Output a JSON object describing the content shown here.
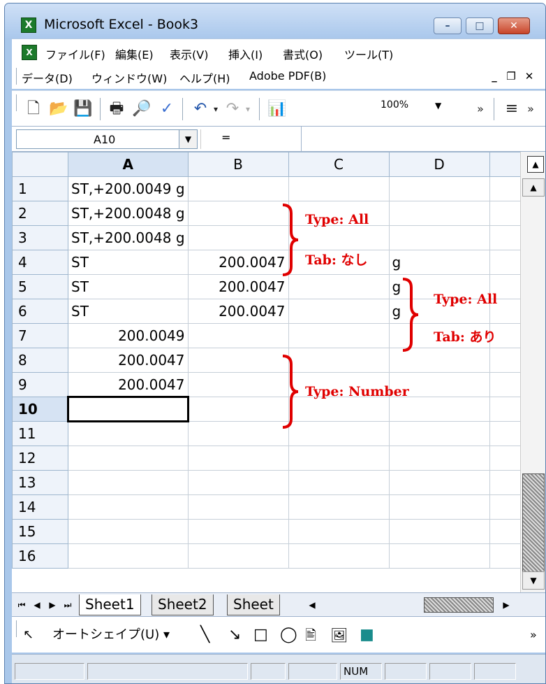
{
  "window": {
    "title": "Microsoft Excel - Book3",
    "minimize": "–",
    "maximize": "□",
    "close": "✕"
  },
  "menu": {
    "row1": [
      "ファイル(F)",
      "編集(E)",
      "表示(V)",
      "挿入(I)",
      "書式(O)",
      "ツール(T)"
    ],
    "row2": [
      "データ(D)",
      "ウィンドウ(W)",
      "ヘルプ(H)",
      "Adobe PDF(B)"
    ]
  },
  "toolbar": {
    "zoom_value": "100%"
  },
  "formula_bar": {
    "name_box": "A10",
    "fx_symbol": "="
  },
  "columns": [
    "A",
    "B",
    "C",
    "D"
  ],
  "rows": [
    {
      "n": "1",
      "A": "ST,+200.0049  g",
      "B": "",
      "C": "",
      "D": ""
    },
    {
      "n": "2",
      "A": "ST,+200.0048  g",
      "B": "",
      "C": "",
      "D": ""
    },
    {
      "n": "3",
      "A": "ST,+200.0048  g",
      "B": "",
      "C": "",
      "D": ""
    },
    {
      "n": "4",
      "A": "ST",
      "B": "200.0047",
      "C": "",
      "D": "g"
    },
    {
      "n": "5",
      "A": "ST",
      "B": "200.0047",
      "C": "",
      "D": "g"
    },
    {
      "n": "6",
      "A": "ST",
      "B": "200.0047",
      "C": "",
      "D": "g"
    },
    {
      "n": "7",
      "A": "200.0049",
      "B": "",
      "C": "",
      "D": ""
    },
    {
      "n": "8",
      "A": "200.0047",
      "B": "",
      "C": "",
      "D": ""
    },
    {
      "n": "9",
      "A": "200.0047",
      "B": "",
      "C": "",
      "D": ""
    },
    {
      "n": "10",
      "A": "",
      "B": "",
      "C": "",
      "D": ""
    },
    {
      "n": "11",
      "A": "",
      "B": "",
      "C": "",
      "D": ""
    },
    {
      "n": "12",
      "A": "",
      "B": "",
      "C": "",
      "D": ""
    },
    {
      "n": "13",
      "A": "",
      "B": "",
      "C": "",
      "D": ""
    },
    {
      "n": "14",
      "A": "",
      "B": "",
      "C": "",
      "D": ""
    },
    {
      "n": "15",
      "A": "",
      "B": "",
      "C": "",
      "D": ""
    },
    {
      "n": "16",
      "A": "",
      "B": "",
      "C": "",
      "D": ""
    }
  ],
  "annotations": {
    "group1_type": "Type: All",
    "group1_tab": "Tab: なし",
    "group2_type": "Type: All",
    "group2_tab": "Tab: あり",
    "group3_type": "Type: Number",
    "color": "#e00000"
  },
  "sheet_tabs": [
    "Sheet1",
    "Sheet2",
    "Sheet"
  ],
  "drawing_toolbar": {
    "autoshape": "オートシェイプ(U) ▾"
  },
  "status": {
    "num": "NUM"
  }
}
